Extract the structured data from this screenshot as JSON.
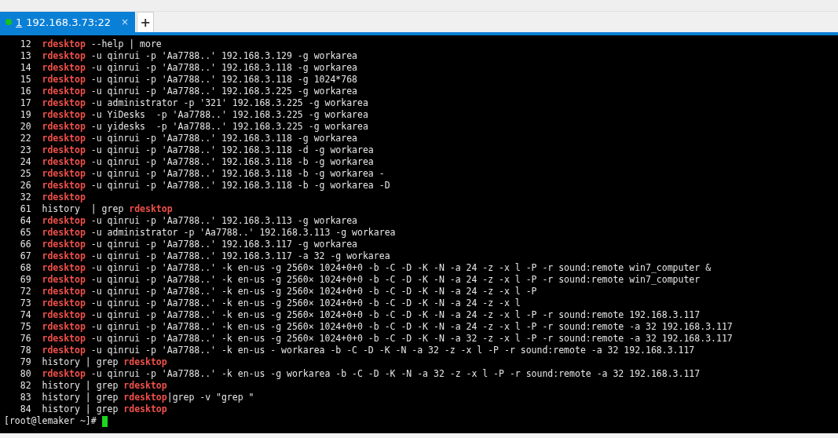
{
  "tabs": [
    {
      "number": "1",
      "label": "192.168.3.73:22",
      "connected": true,
      "selected": true,
      "close": "×"
    }
  ],
  "new_tab": "+",
  "lines": [
    {
      "num": "12",
      "parts": [
        {
          "text": "rdesktop",
          "match": true
        },
        {
          "text": " --help | more",
          "match": false
        }
      ]
    },
    {
      "num": "13",
      "parts": [
        {
          "text": "rdesktop",
          "match": true
        },
        {
          "text": " -u qinrui -p 'Aa7788..' 192.168.3.129 -g workarea",
          "match": false
        }
      ]
    },
    {
      "num": "14",
      "parts": [
        {
          "text": "rdesktop",
          "match": true
        },
        {
          "text": " -u qinrui -p 'Aa7788..' 192.168.3.118 -g workarea",
          "match": false
        }
      ]
    },
    {
      "num": "15",
      "parts": [
        {
          "text": "rdesktop",
          "match": true
        },
        {
          "text": " -u qinrui -p 'Aa7788..' 192.168.3.118 -g 1024*768",
          "match": false
        }
      ]
    },
    {
      "num": "16",
      "parts": [
        {
          "text": "rdesktop",
          "match": true
        },
        {
          "text": " -u qinrui -p 'Aa7788..' 192.168.3.225 -g workarea",
          "match": false
        }
      ]
    },
    {
      "num": "17",
      "parts": [
        {
          "text": "rdesktop",
          "match": true
        },
        {
          "text": " -u administrator -p '321' 192.168.3.225 -g workarea",
          "match": false
        }
      ]
    },
    {
      "num": "19",
      "parts": [
        {
          "text": "rdesktop",
          "match": true
        },
        {
          "text": " -u YiDesks  -p 'Aa7788..' 192.168.3.225 -g workarea",
          "match": false
        }
      ]
    },
    {
      "num": "20",
      "parts": [
        {
          "text": "rdesktop",
          "match": true
        },
        {
          "text": " -u yidesks  -p 'Aa7788..' 192.168.3.225 -g workarea",
          "match": false
        }
      ]
    },
    {
      "num": "22",
      "parts": [
        {
          "text": "rdesktop",
          "match": true
        },
        {
          "text": " -u qinrui -p 'Aa7788..' 192.168.3.118 -g workarea",
          "match": false
        }
      ]
    },
    {
      "num": "23",
      "parts": [
        {
          "text": "rdesktop",
          "match": true
        },
        {
          "text": " -u qinrui -p 'Aa7788..' 192.168.3.118 -d -g workarea",
          "match": false
        }
      ]
    },
    {
      "num": "24",
      "parts": [
        {
          "text": "rdesktop",
          "match": true
        },
        {
          "text": " -u qinrui -p 'Aa7788..' 192.168.3.118 -b -g workarea",
          "match": false
        }
      ]
    },
    {
      "num": "25",
      "parts": [
        {
          "text": "rdesktop",
          "match": true
        },
        {
          "text": " -u qinrui -p 'Aa7788..' 192.168.3.118 -b -g workarea -",
          "match": false
        }
      ]
    },
    {
      "num": "26",
      "parts": [
        {
          "text": "rdesktop",
          "match": true
        },
        {
          "text": " -u qinrui -p 'Aa7788..' 192.168.3.118 -b -g workarea -D",
          "match": false
        }
      ]
    },
    {
      "num": "32",
      "parts": [
        {
          "text": "rdesktop",
          "match": true
        }
      ]
    },
    {
      "num": "61",
      "parts": [
        {
          "text": "history  | grep ",
          "match": false
        },
        {
          "text": "rdesktop",
          "match": true
        }
      ]
    },
    {
      "num": "64",
      "parts": [
        {
          "text": "rdesktop",
          "match": true
        },
        {
          "text": " -u qinrui -p 'Aa7788..' 192.168.3.113 -g workarea",
          "match": false
        }
      ]
    },
    {
      "num": "65",
      "parts": [
        {
          "text": "rdesktop",
          "match": true
        },
        {
          "text": " -u administrator -p 'Aa7788..' 192.168.3.113 -g workarea",
          "match": false
        }
      ]
    },
    {
      "num": "66",
      "parts": [
        {
          "text": "rdesktop",
          "match": true
        },
        {
          "text": " -u qinrui -p 'Aa7788..' 192.168.3.117 -g workarea",
          "match": false
        }
      ]
    },
    {
      "num": "67",
      "parts": [
        {
          "text": "rdesktop",
          "match": true
        },
        {
          "text": " -u qinrui -p 'Aa7788..' 192.168.3.117 -a 32 -g workarea",
          "match": false
        }
      ]
    },
    {
      "num": "68",
      "parts": [
        {
          "text": "rdesktop",
          "match": true
        },
        {
          "text": " -u qinrui -p 'Aa7788..' -k en-us -g 2560× 1024+0+0 -b -C -D -K -N -a 24 -z -x l -P -r sound:remote win7_computer &",
          "match": false
        }
      ]
    },
    {
      "num": "69",
      "parts": [
        {
          "text": "rdesktop",
          "match": true
        },
        {
          "text": " -u qinrui -p 'Aa7788..' -k en-us -g 2560× 1024+0+0 -b -C -D -K -N -a 24 -z -x l -P -r sound:remote win7_computer",
          "match": false
        }
      ]
    },
    {
      "num": "72",
      "parts": [
        {
          "text": "rdesktop",
          "match": true
        },
        {
          "text": " -u qinrui -p 'Aa7788..' -k en-us -g 2560× 1024+0+0 -b -C -D -K -N -a 24 -z -x l -P",
          "match": false
        }
      ]
    },
    {
      "num": "73",
      "parts": [
        {
          "text": "rdesktop",
          "match": true
        },
        {
          "text": " -u qinrui -p 'Aa7788..' -k en-us -g 2560× 1024+0+0 -b -C -D -K -N -a 24 -z -x l",
          "match": false
        }
      ]
    },
    {
      "num": "74",
      "parts": [
        {
          "text": "rdesktop",
          "match": true
        },
        {
          "text": " -u qinrui -p 'Aa7788..' -k en-us -g 2560× 1024+0+0 -b -C -D -K -N -a 24 -z -x l -P -r sound:remote 192.168.3.117",
          "match": false
        }
      ]
    },
    {
      "num": "75",
      "parts": [
        {
          "text": "rdesktop",
          "match": true
        },
        {
          "text": " -u qinrui -p 'Aa7788..' -k en-us -g 2560× 1024+0+0 -b -C -D -K -N -a 24 -z -x l -P -r sound:remote -a 32 192.168.3.117",
          "match": false
        }
      ]
    },
    {
      "num": "76",
      "parts": [
        {
          "text": "rdesktop",
          "match": true
        },
        {
          "text": " -u qinrui -p 'Aa7788..' -k en-us -g 2560× 1024+0+0 -b -C -D -K -N -a 32 -z -x l -P -r sound:remote -a 32 192.168.3.117",
          "match": false
        }
      ]
    },
    {
      "num": "78",
      "parts": [
        {
          "text": "rdesktop",
          "match": true
        },
        {
          "text": " -u qinrui -p 'Aa7788..' -k en-us - workarea -b -C -D -K -N -a 32 -z -x l -P -r sound:remote -a 32 192.168.3.117",
          "match": false
        }
      ]
    },
    {
      "num": "79",
      "parts": [
        {
          "text": "history | grep ",
          "match": false
        },
        {
          "text": "rdesktop",
          "match": true
        }
      ]
    },
    {
      "num": "80",
      "parts": [
        {
          "text": "rdesktop",
          "match": true
        },
        {
          "text": " -u qinrui -p 'Aa7788..' -k en-us -g workarea -b -C -D -K -N -a 32 -z -x l -P -r sound:remote -a 32 192.168.3.117",
          "match": false
        }
      ]
    },
    {
      "num": "82",
      "parts": [
        {
          "text": "history | grep ",
          "match": false
        },
        {
          "text": "rdesktop",
          "match": true
        }
      ]
    },
    {
      "num": "83",
      "parts": [
        {
          "text": "history | grep ",
          "match": false
        },
        {
          "text": "rdesktop",
          "match": true
        },
        {
          "text": "|grep -v \"grep \"",
          "match": false
        }
      ]
    },
    {
      "num": "84",
      "parts": [
        {
          "text": "history | grep ",
          "match": false
        },
        {
          "text": "rdesktop",
          "match": true
        }
      ]
    }
  ],
  "prompt": "[root@lemaker ~]#"
}
